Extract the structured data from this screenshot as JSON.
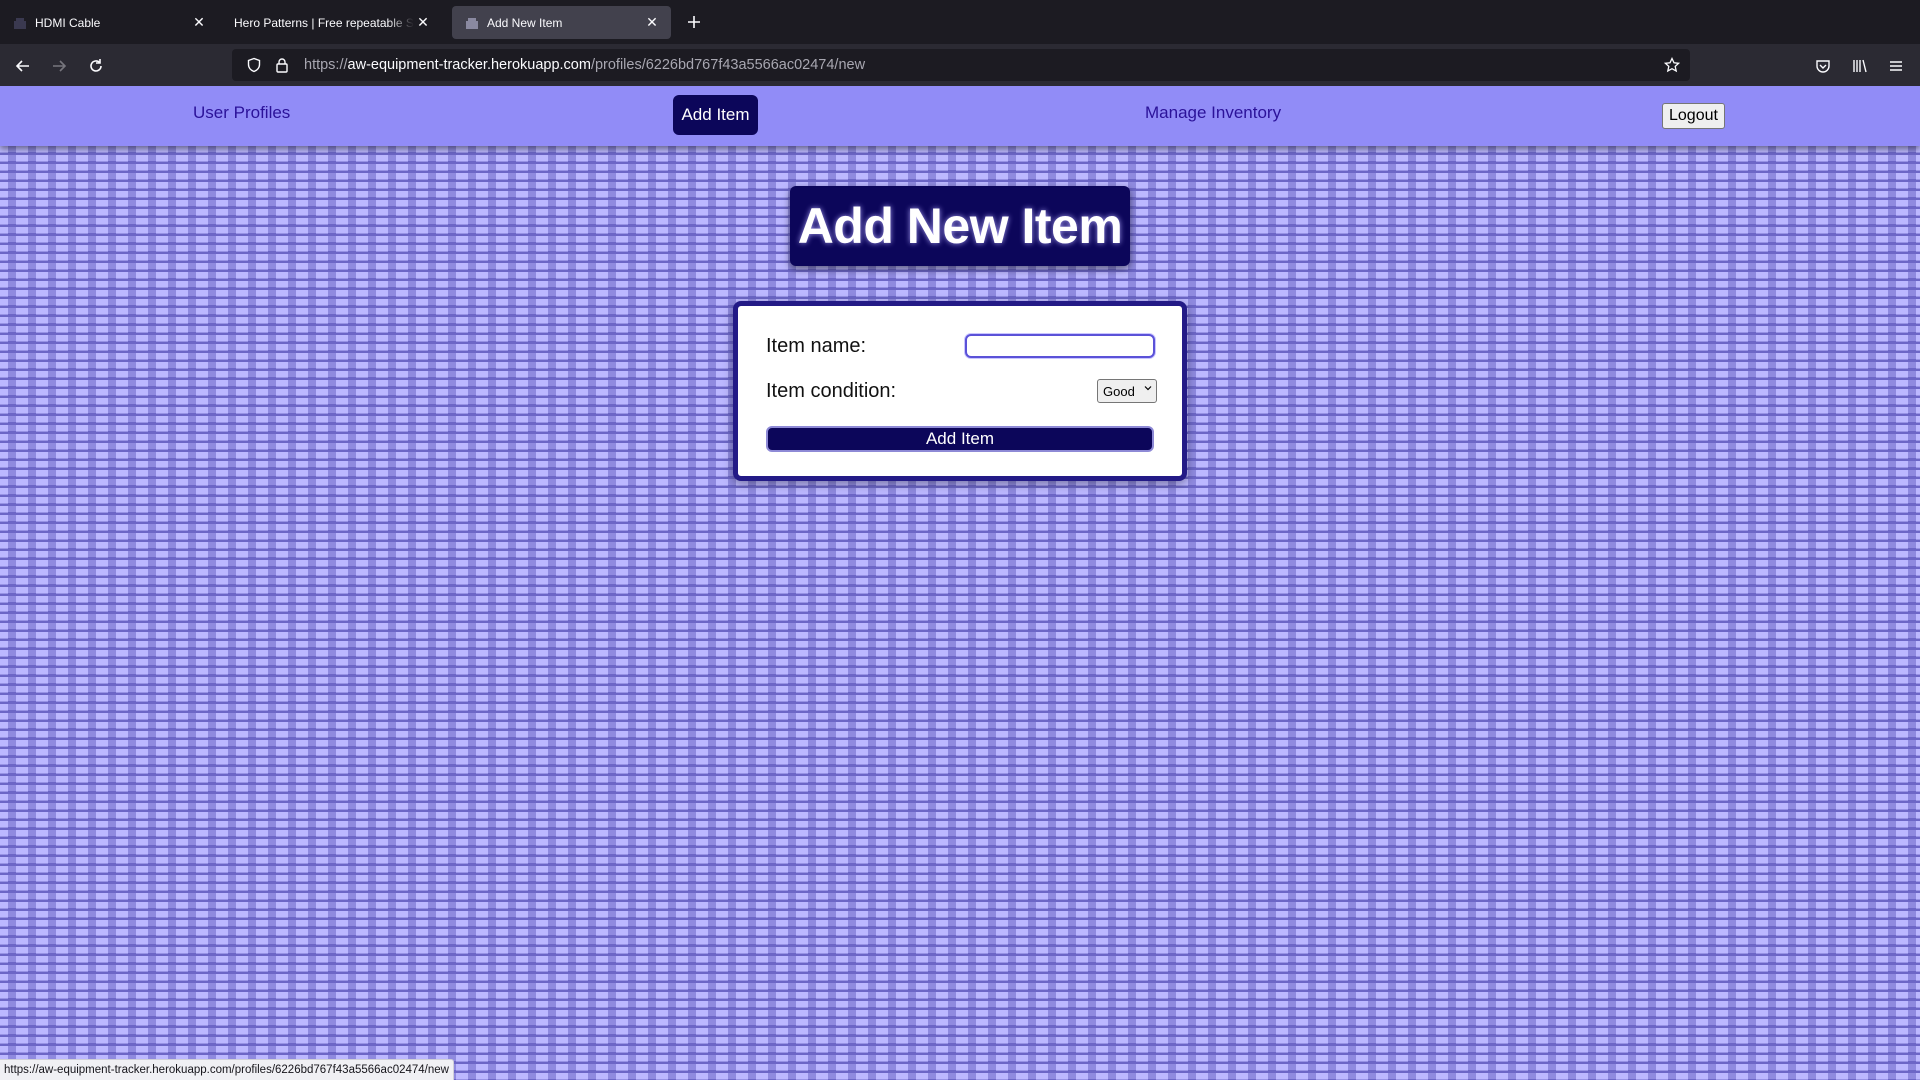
{
  "browser": {
    "tabs": [
      {
        "title": "HDMI Cable",
        "favicon": "app-favicon-icon",
        "active": false
      },
      {
        "title": "Hero Patterns | Free repeatable SVG background patterns",
        "favicon": "",
        "active": false
      },
      {
        "title": "Add New Item",
        "favicon": "app-favicon-icon",
        "active": true
      }
    ],
    "url": {
      "scheme": "https://",
      "host": "aw-equipment-tracker.herokuapp.com",
      "path": "/profiles/6226bd767f43a5566ac02474/new"
    },
    "status_url": "https://aw-equipment-tracker.herokuapp.com/profiles/6226bd767f43a5566ac02474/new"
  },
  "site_nav": {
    "user_profiles": "User Profiles",
    "add_item": "Add Item",
    "manage_inventory": "Manage Inventory",
    "logout": "Logout"
  },
  "page": {
    "title": "Add New Item"
  },
  "form": {
    "name_label": "Item name:",
    "name_value": "",
    "condition_label": "Item condition:",
    "condition_value": "Good",
    "submit_label": "Add Item"
  },
  "colors": {
    "accent_dark": "#0c065a",
    "nav_bg": "#918cf7",
    "pattern_light": "#bcb8ff",
    "pattern_dark": "#6c66c6"
  }
}
